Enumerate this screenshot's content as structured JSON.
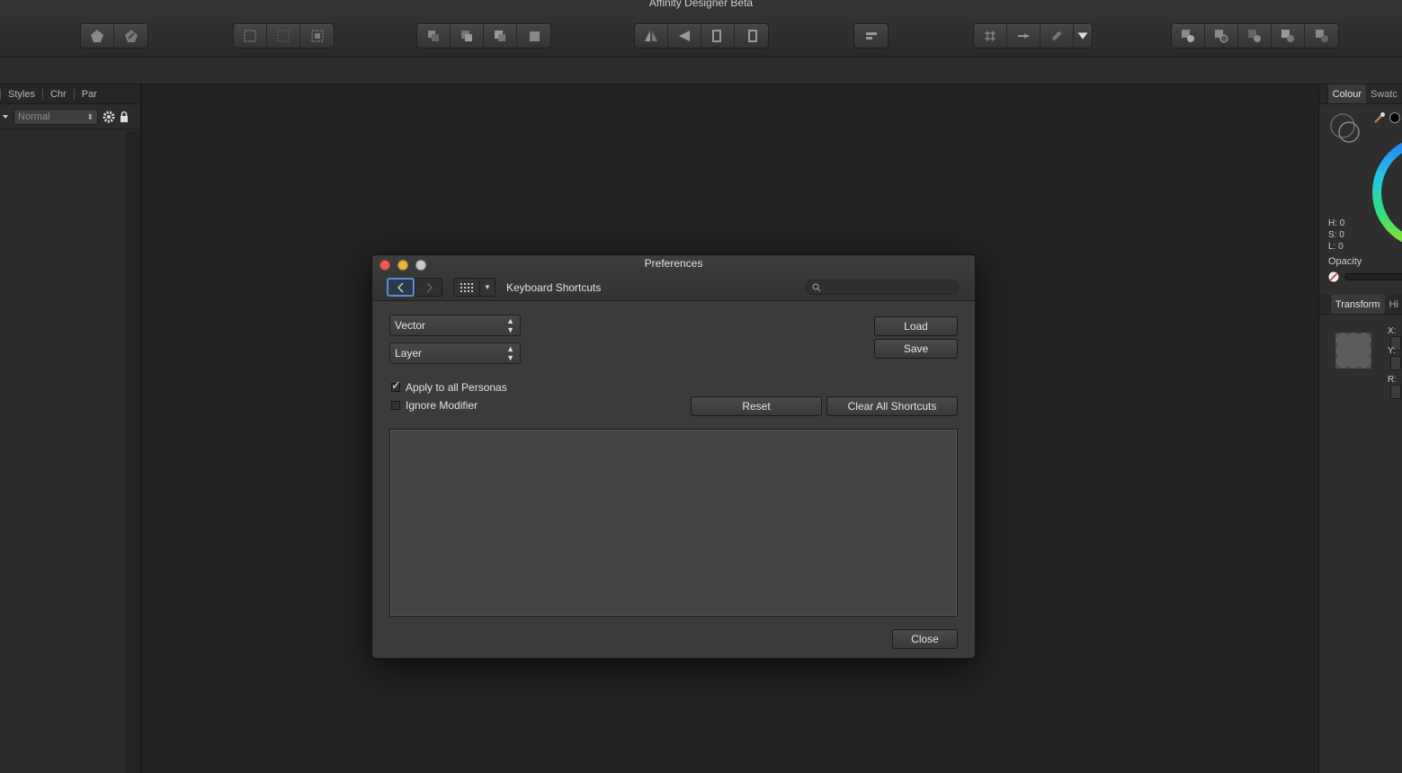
{
  "app": {
    "title": "Affinity Designer Beta"
  },
  "toolbar": {
    "groups": [
      [
        "persona-designer-icon",
        "persona-export-icon"
      ],
      [
        "select-all-icon",
        "deselect-icon",
        "invert-selection-icon"
      ],
      [
        "move-to-back-icon",
        "move-back-one-icon",
        "move-forward-one-icon",
        "move-to-front-icon"
      ],
      [
        "flip-horizontal-icon",
        "flip-vertical-icon",
        "rotate-left-icon",
        "rotate-right-icon"
      ],
      [
        "align-icon"
      ],
      [
        "snapping-icon",
        "snap-options-icon",
        "magnet-icon",
        "dropdown-icon"
      ],
      [
        "boolean-add-icon",
        "boolean-subtract-icon",
        "boolean-intersect-icon",
        "boolean-xor-icon",
        "boolean-divide-icon"
      ]
    ]
  },
  "left_panel": {
    "tabs": [
      "Styles",
      "Chr",
      "Par"
    ],
    "blend_mode": "Normal"
  },
  "right_panel": {
    "colour_tabs": [
      "Colour",
      "Swatc"
    ],
    "hsl": {
      "h": "H: 0",
      "s": "S: 0",
      "l": "L: 0"
    },
    "opacity_label": "Opacity",
    "transform_tabs": [
      "Transform",
      "Hi"
    ],
    "fields": {
      "x": "X:",
      "y": "Y:",
      "r": "R:"
    }
  },
  "dialog": {
    "title": "Preferences",
    "section": "Keyboard Shortcuts",
    "search_placeholder": "",
    "persona_select": "Vector",
    "category_select": "Layer",
    "apply_all_label": "Apply to all Personas",
    "apply_all_checked": true,
    "ignore_modifier_label": "Ignore Modifier",
    "ignore_modifier_checked": false,
    "load_label": "Load",
    "save_label": "Save",
    "reset_label": "Reset",
    "clear_all_label": "Clear All Shortcuts",
    "close_label": "Close"
  },
  "colors": {
    "accent": "#5b8dd6",
    "traffic_close": "#ee5a52",
    "traffic_min": "#e7b83a",
    "traffic_max": "#c9c9c9"
  }
}
